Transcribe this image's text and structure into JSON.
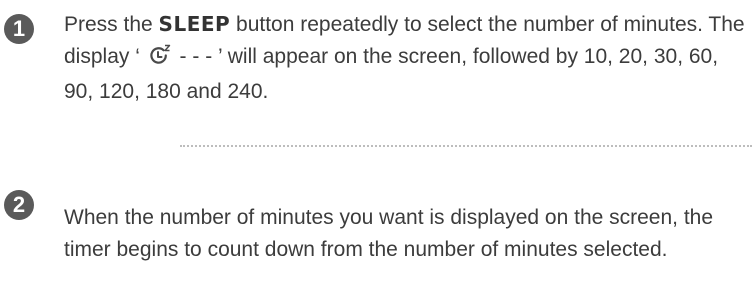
{
  "steps": [
    {
      "number": "1",
      "text_part1": "Press the ",
      "keyword": "SLEEP",
      "text_part2": " button repeatedly to select the number of minutes. The display ‘ ",
      "icon": "sleep-timer-icon",
      "text_part3": " - - - ’ will appear on the screen, followed by 10, 20, 30, 60, 90, 120, 180 and 240."
    },
    {
      "number": "2",
      "text": "When the number of minutes you want is displayed on the screen, the timer begins to count down from the number of minutes selected."
    }
  ],
  "colors": {
    "badge": "#5a5a5a",
    "text": "#3c3c3c",
    "divider": "#bdbdbd"
  }
}
